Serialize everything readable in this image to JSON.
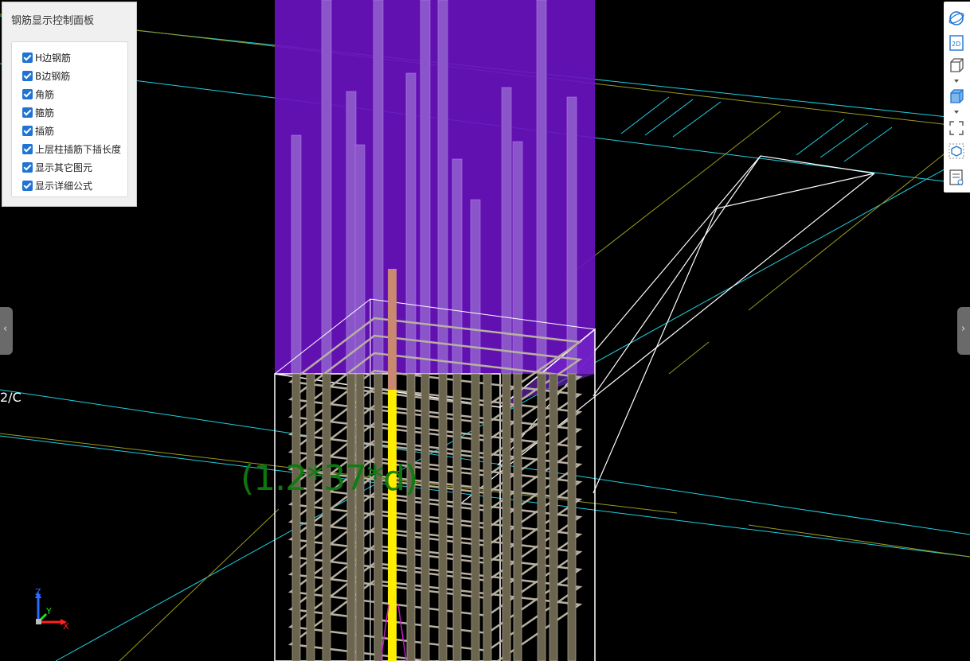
{
  "panel": {
    "title": "钢筋显示控制面板",
    "options": [
      {
        "label": "H边钢筋",
        "checked": true
      },
      {
        "label": "B边钢筋",
        "checked": true
      },
      {
        "label": "角筋",
        "checked": true
      },
      {
        "label": "箍筋",
        "checked": true
      },
      {
        "label": "插筋",
        "checked": true
      },
      {
        "label": "上层柱插筋下插长度",
        "checked": true
      },
      {
        "label": "显示其它图元",
        "checked": true
      },
      {
        "label": "显示详细公式",
        "checked": true
      }
    ]
  },
  "viewport": {
    "grid_label": "2/C",
    "formula": "(1.2*37*d)"
  },
  "axis_triad": {
    "z": "Z",
    "y": "Y",
    "x": "X"
  },
  "toolbar": {
    "icons": [
      "orbit-icon",
      "2d-view-icon",
      "3d-wire-view-icon",
      "3d-solid-view-icon",
      "fit-view-icon",
      "element-display-icon",
      "display-settings-icon"
    ],
    "view_2d_label": "2D"
  },
  "colors": {
    "background": "#000000",
    "upper_column": "#6a12c0",
    "rebar": "#a8a08c",
    "highlight_rebar": "#ffee00",
    "formula": "#0f7d0f",
    "axis_line": "#00d0e0",
    "accent": "#1f74d3"
  }
}
